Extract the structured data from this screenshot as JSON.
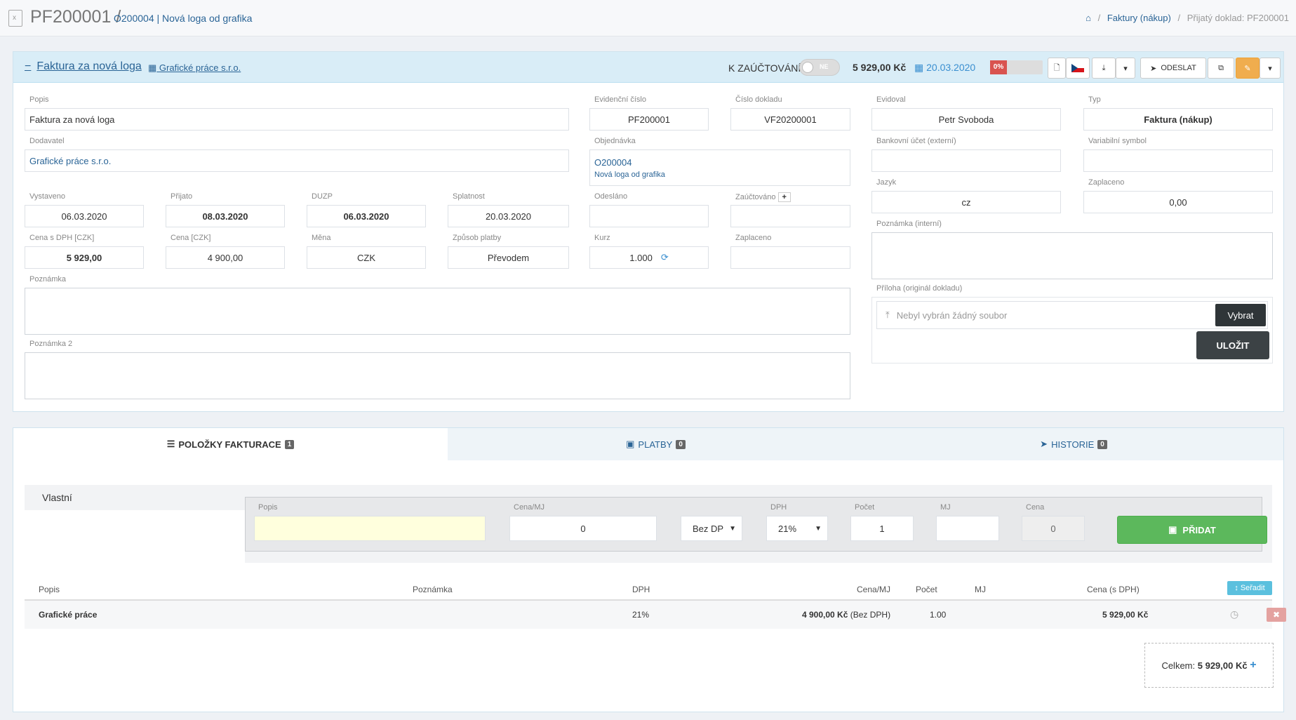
{
  "header": {
    "title": "PF200001",
    "separator": "/",
    "order_no": "O200004",
    "order_name": "| Nová loga od grafika",
    "breadcrumb": [
      "Faktury (nákup)",
      "Přijatý doklad: PF200001"
    ],
    "breadcrumb_sep": "/"
  },
  "panel": {
    "collapse_symbol": "−",
    "title": "Faktura za nová loga",
    "supplier_link": "Grafické práce s.r.o.",
    "k_zauctovani": "K ZAÚČTOVÁNÍ",
    "toggle_label": "NE",
    "amount": "5 929,00 Kč",
    "date": "20.03.2020",
    "progress_label": "0%",
    "progress_pct": 0,
    "send_label": "ODESLAT"
  },
  "fields": {
    "popis": {
      "label": "Popis",
      "value": "Faktura za nová loga"
    },
    "evidencni": {
      "label": "Evidenční číslo",
      "value": "PF200001"
    },
    "cislo_dokladu": {
      "label": "Číslo dokladu",
      "value": "VF20200001"
    },
    "evidoval": {
      "label": "Evidoval",
      "value": "Petr Svoboda"
    },
    "typ": {
      "label": "Typ",
      "value": "Faktura (nákup)"
    },
    "dodavatel": {
      "label": "Dodavatel",
      "value": "Grafické práce s.r.o."
    },
    "objednavka": {
      "label": "Objednávka",
      "value": "O200004",
      "sub": "Nová loga od grafika"
    },
    "bank": {
      "label": "Bankovní účet (externí)",
      "value": ""
    },
    "vs": {
      "label": "Variabilní symbol",
      "value": ""
    },
    "vystaveno": {
      "label": "Vystaveno",
      "value": "06.03.2020"
    },
    "prijato": {
      "label": "Přijato",
      "value": "08.03.2020"
    },
    "duzp": {
      "label": "DUZP",
      "value": "06.03.2020"
    },
    "splatnost": {
      "label": "Splatnost",
      "value": "20.03.2020"
    },
    "odeslano": {
      "label": "Odesláno",
      "value": ""
    },
    "zauctovano": {
      "label": "Zaúčtováno",
      "value": ""
    },
    "jazyk": {
      "label": "Jazyk",
      "value": "cz"
    },
    "zaplaceno_r": {
      "label": "Zaplaceno",
      "value": "0,00"
    },
    "cena_dph": {
      "label": "Cena s DPH [CZK]",
      "value": "5 929,00"
    },
    "cena": {
      "label": "Cena [CZK]",
      "value": "4 900,00"
    },
    "mena": {
      "label": "Měna",
      "value": "CZK"
    },
    "zpusob": {
      "label": "Způsob platby",
      "value": "Převodem"
    },
    "kurz": {
      "label": "Kurz",
      "value": "1.000"
    },
    "zaplaceno": {
      "label": "Zaplaceno",
      "value": ""
    },
    "poznamka_int": {
      "label": "Poznámka (interní)"
    },
    "poznamka": {
      "label": "Poznámka"
    },
    "poznamka2": {
      "label": "Poznámka 2"
    },
    "priloha": {
      "label": "Příloha (originál dokladu)",
      "placeholder": "Nebyl vybrán žádný soubor",
      "choose": "Vybrat",
      "save": "ULOŽIT"
    }
  },
  "tabs": [
    {
      "label": "POLOŽKY FAKTURACE",
      "count": "1"
    },
    {
      "label": "PLATBY",
      "count": "0"
    },
    {
      "label": "HISTORIE",
      "count": "0"
    }
  ],
  "items": {
    "side_label": "Vlastní",
    "form": {
      "popis_label": "Popis",
      "popis_value": "",
      "cena_mj_label": "Cena/MJ",
      "cena_mj_value": "0",
      "dph_type": "Bez DPH",
      "dph_label": "DPH",
      "dph_value": "21%",
      "pocet_label": "Počet",
      "pocet_value": "1",
      "mj_label": "MJ",
      "mj_value": "",
      "cena_label": "Cena",
      "cena_value": "0",
      "add": "PŘIDAT"
    },
    "columns": [
      "Popis",
      "Poznámka",
      "DPH",
      "Cena/MJ",
      "Počet",
      "MJ",
      "Cena (s DPH)"
    ],
    "sort": "Seřadit",
    "rows": [
      {
        "popis": "Grafické práce",
        "poznamka": "",
        "dph": "21%",
        "cena_mj": "4 900,00 Kč",
        "cena_mj_note": "(Bez DPH)",
        "pocet": "1.00",
        "mj": "",
        "cena": "5 929,00 Kč"
      }
    ],
    "total_label": "Celkem:",
    "total_value": "5 929,00 Kč"
  }
}
